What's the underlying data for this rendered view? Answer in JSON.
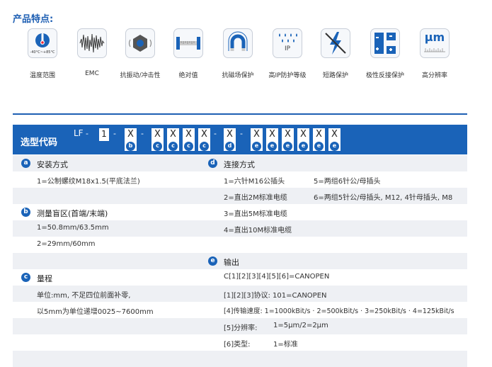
{
  "features_title": "产品特点:",
  "features": [
    {
      "icon": "thermometer-icon",
      "icon_text": "-40°C~+85°C",
      "label": "温度范围"
    },
    {
      "icon": "emc-wave-icon",
      "icon_text": "",
      "label": "EMC"
    },
    {
      "icon": "nut-vibration-icon",
      "icon_text": "",
      "label": "抗振动/冲击性"
    },
    {
      "icon": "ruler-icon",
      "icon_text": "",
      "label": "绝对值"
    },
    {
      "icon": "magnet-icon",
      "icon_text": "",
      "label": "抗磁场保护"
    },
    {
      "icon": "water-drops-icon",
      "icon_text": "IP",
      "label": "高IP防护等级"
    },
    {
      "icon": "lightning-icon",
      "icon_text": "",
      "label": "短路保护"
    },
    {
      "icon": "polarity-icon",
      "icon_text": "",
      "label": "极性反接保护"
    },
    {
      "icon": "resolution-icon",
      "icon_text": "µm",
      "label": "高分辨率"
    }
  ],
  "code": {
    "title": "选型代码",
    "prefix": "LF",
    "dash": "-",
    "fixed": "1",
    "x": "X",
    "badges": {
      "b": "b",
      "c": "c",
      "d": "d",
      "e": "e"
    }
  },
  "sections": {
    "a": {
      "letter": "a",
      "title": "安装方式",
      "rows": [
        "1=公制螺纹M18x1.5(平底法兰)"
      ]
    },
    "b": {
      "letter": "b",
      "title": "测量盲区(首端/末端)",
      "rows": [
        "1=50.8mm/63.5mm",
        "2=29mm/60mm"
      ]
    },
    "c": {
      "letter": "c",
      "title": "量程",
      "rows": [
        "单位:mm, 不足四位前面补零,",
        "以5mm为单位递增0025~7600mm"
      ]
    },
    "d": {
      "letter": "d",
      "title": "连接方式",
      "rows": [
        {
          "left": "1=六针M16公插头",
          "right": "5=两组6针公/母插头"
        },
        {
          "left": "2=直出2M标准电缆",
          "right": "6=两组5针公/母插头, M12, 4针母插头, M8"
        },
        {
          "left": "3=直出5M标准电缆",
          "right": ""
        },
        {
          "left": "4=直出10M标准电缆",
          "right": ""
        }
      ]
    },
    "e": {
      "letter": "e",
      "title": "输出",
      "rows": [
        {
          "left": "C[1][2][3][4][5][6]=CANOPEN",
          "right": ""
        },
        {
          "left": "[1][2][3]协议:  101=CANOPEN",
          "right": ""
        },
        {
          "left": "[4]传输速度:  1=1000kBit/s · 2=500kBit/s · 3=250kBit/s · 4=125kBit/s",
          "right": ""
        },
        {
          "left": "[5]分辨率:",
          "right": "1=5µm/2=2µm"
        },
        {
          "left": "[6]类型:",
          "right": "1=标准"
        }
      ]
    }
  }
}
